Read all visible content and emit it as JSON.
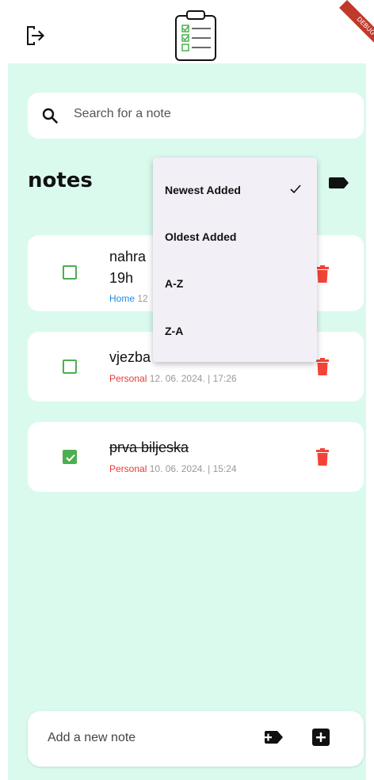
{
  "debug_banner": "DEBUG",
  "search": {
    "placeholder": "Search for a note"
  },
  "header": {
    "title": "notes"
  },
  "sort_menu": {
    "options": [
      "Newest Added",
      "Oldest Added",
      "A-Z",
      "Z-A"
    ],
    "selected": "Newest Added"
  },
  "notes": [
    {
      "title_line1": "nahra",
      "title_line2": "19h",
      "category": "Home",
      "date": "12",
      "checked": false
    },
    {
      "title": "vjezba",
      "category": "Personal",
      "date": "12. 06. 2024. | 17:26",
      "checked": false
    },
    {
      "title": "prva biljeska",
      "category": "Personal",
      "date": "10. 06. 2024. | 15:24",
      "checked": true
    }
  ],
  "add_bar": {
    "placeholder": "Add a new note"
  },
  "colors": {
    "background": "#dafaee",
    "checkbox": "#4caf50",
    "delete": "#f44336",
    "home": "#1e88e5",
    "personal": "#e53935"
  }
}
